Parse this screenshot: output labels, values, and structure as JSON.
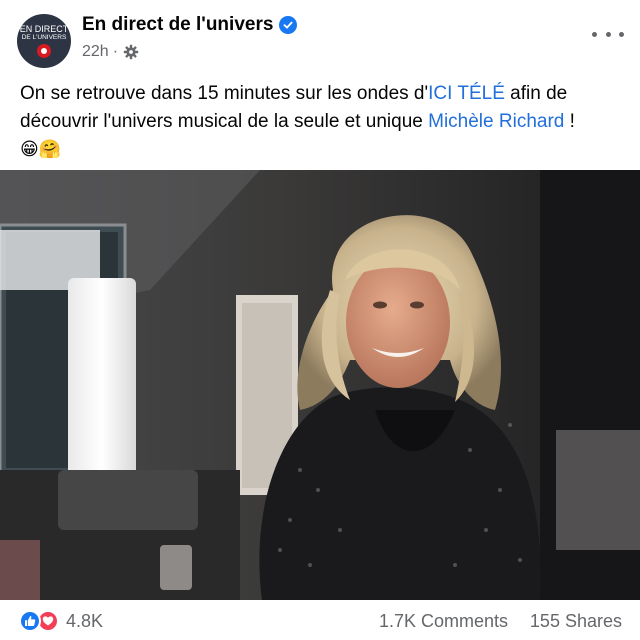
{
  "post": {
    "author": "En direct de l'univers",
    "avatar_lines": [
      "EN DIRECT",
      "DE L'UNIVERS"
    ],
    "time": "22h",
    "meta_separator": "·",
    "privacy_icon": "gear-icon",
    "text_parts": [
      "On se retrouve dans 15 minutes sur les ondes d'",
      "ICI TÉLÉ",
      " afin de découvrir l'univers musical de la seule et unique ",
      "Michèle Richard",
      " !"
    ],
    "emoji": "😁🤗"
  },
  "stats": {
    "reactions_count": "4.8K",
    "comments": "1.7K Comments",
    "shares": "155 Shares"
  },
  "colors": {
    "link": "#216fdb",
    "like": "#1877f2",
    "love": "#f33e58",
    "secondary_text": "#65676b"
  }
}
